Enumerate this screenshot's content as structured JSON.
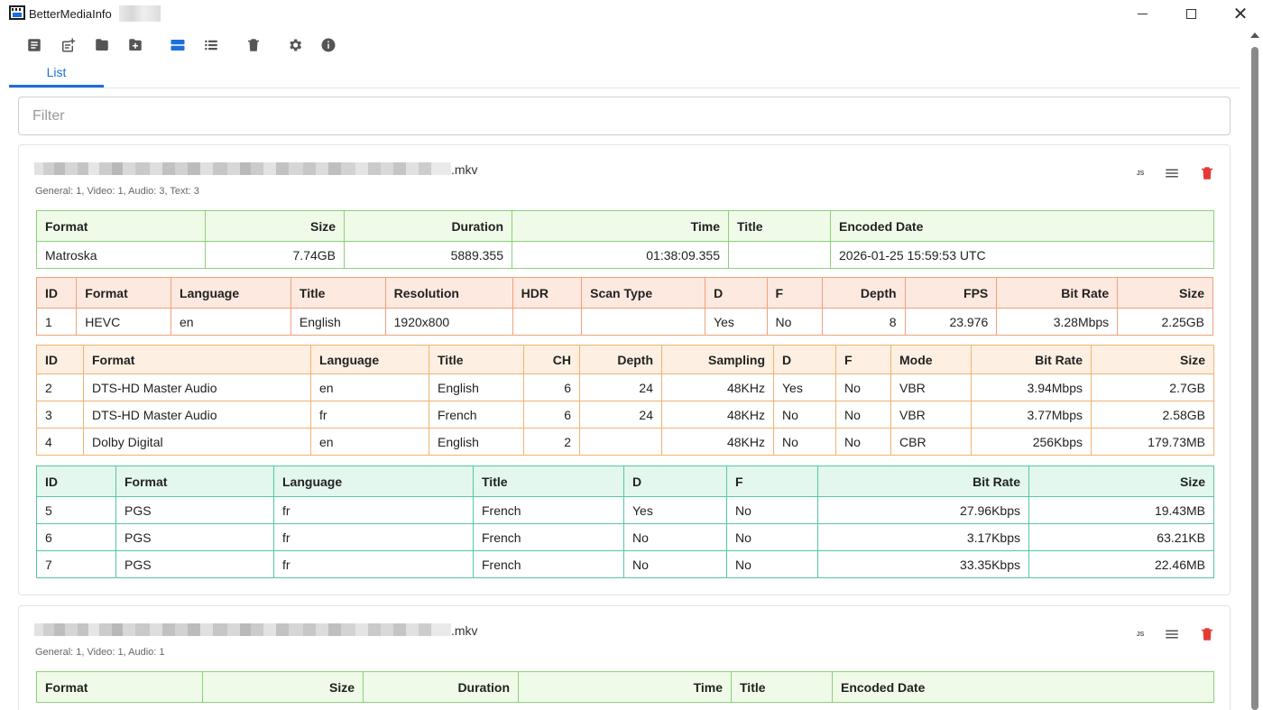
{
  "window": {
    "title": "BetterMediaInfo",
    "close_glyph": "✕"
  },
  "toolbar": {
    "buttons": [
      {
        "name": "add-file-button",
        "icon": "document-icon"
      },
      {
        "name": "add-file-plus-button",
        "icon": "document-plus-icon"
      },
      {
        "name": "open-folder-button",
        "icon": "folder-icon"
      },
      {
        "name": "add-folder-button",
        "icon": "folder-plus-icon"
      },
      {
        "name": "card-view-button",
        "icon": "card-view-icon",
        "active": true
      },
      {
        "name": "list-view-button",
        "icon": "list-view-icon"
      },
      {
        "name": "clear-all-button",
        "icon": "trash-icon"
      },
      {
        "name": "settings-button",
        "icon": "gear-icon"
      },
      {
        "name": "about-button",
        "icon": "info-icon"
      }
    ],
    "accent_color": "#1e6fd9"
  },
  "tabs": [
    {
      "label": "List",
      "active": true
    }
  ],
  "filter": {
    "placeholder": "Filter",
    "value": ""
  },
  "files": [
    {
      "extension": ".mkv",
      "summary": "General: 1, Video: 1, Audio: 3, Text: 3",
      "actions": {
        "json_label": "JS",
        "details_icon": "lines-icon",
        "delete_icon": "trash-icon",
        "delete_color": "#e53935"
      },
      "general": {
        "headers": [
          "Format",
          "Size",
          "Duration",
          "Time",
          "Title",
          "Encoded Date"
        ],
        "rows": [
          [
            "Matroska",
            "7.74GB",
            "5889.355",
            "01:38:09.355",
            "",
            "2026-01-25 15:59:53 UTC"
          ]
        ]
      },
      "video": {
        "headers": [
          "ID",
          "Format",
          "Language",
          "Title",
          "Resolution",
          "HDR",
          "Scan Type",
          "D",
          "F",
          "Depth",
          "FPS",
          "Bit Rate",
          "Size"
        ],
        "rows": [
          [
            "1",
            "HEVC",
            "en",
            "English",
            "1920x800",
            "",
            "",
            "Yes",
            "No",
            "8",
            "23.976",
            "3.28Mbps",
            "2.25GB"
          ]
        ]
      },
      "audio": {
        "headers": [
          "ID",
          "Format",
          "Language",
          "Title",
          "CH",
          "Depth",
          "Sampling",
          "D",
          "F",
          "Mode",
          "Bit Rate",
          "Size"
        ],
        "rows": [
          [
            "2",
            "DTS-HD Master Audio",
            "en",
            "English",
            "6",
            "24",
            "48KHz",
            "Yes",
            "No",
            "VBR",
            "3.94Mbps",
            "2.7GB"
          ],
          [
            "3",
            "DTS-HD Master Audio",
            "fr",
            "French",
            "6",
            "24",
            "48KHz",
            "No",
            "No",
            "VBR",
            "3.77Mbps",
            "2.58GB"
          ],
          [
            "4",
            "Dolby Digital",
            "en",
            "English",
            "2",
            "",
            "48KHz",
            "No",
            "No",
            "CBR",
            "256Kbps",
            "179.73MB"
          ]
        ]
      },
      "text": {
        "headers": [
          "ID",
          "Format",
          "Language",
          "Title",
          "D",
          "F",
          "Bit Rate",
          "Size"
        ],
        "rows": [
          [
            "5",
            "PGS",
            "fr",
            "French",
            "Yes",
            "No",
            "27.96Kbps",
            "19.43MB"
          ],
          [
            "6",
            "PGS",
            "fr",
            "French",
            "No",
            "No",
            "3.17Kbps",
            "63.21KB"
          ],
          [
            "7",
            "PGS",
            "fr",
            "French",
            "No",
            "No",
            "33.35Kbps",
            "22.46MB"
          ]
        ]
      }
    },
    {
      "extension": ".mkv",
      "summary": "General: 1, Video: 1, Audio: 1",
      "actions": {
        "json_label": "JS",
        "details_icon": "lines-icon",
        "delete_icon": "trash-icon",
        "delete_color": "#e53935"
      },
      "general": {
        "headers": [
          "Format",
          "Size",
          "Duration",
          "Time",
          "Title",
          "Encoded Date"
        ],
        "rows": []
      }
    }
  ]
}
